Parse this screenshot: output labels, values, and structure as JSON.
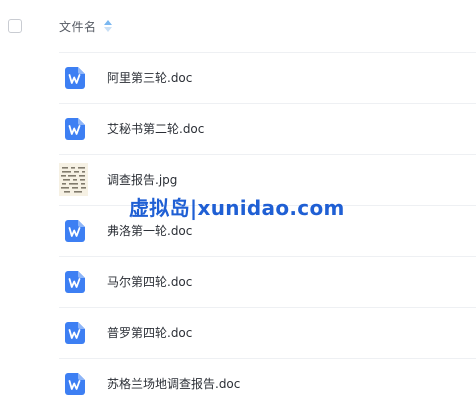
{
  "header": {
    "column_name": "文件名",
    "sort_icon": "sort-toggle-icon"
  },
  "files": [
    {
      "name": "阿里第三轮.doc",
      "icon": "word-doc-icon",
      "type": "doc"
    },
    {
      "name": "艾秘书第二轮.doc",
      "icon": "word-doc-icon",
      "type": "doc"
    },
    {
      "name": "调查报告.jpg",
      "icon": "image-thumbnail-icon",
      "type": "image"
    },
    {
      "name": "弗洛第一轮.doc",
      "icon": "word-doc-icon",
      "type": "doc"
    },
    {
      "name": "马尔第四轮.doc",
      "icon": "word-doc-icon",
      "type": "doc"
    },
    {
      "name": "普罗第四轮.doc",
      "icon": "word-doc-icon",
      "type": "doc"
    },
    {
      "name": "苏格兰场地调查报告.doc",
      "icon": "word-doc-icon",
      "type": "doc"
    }
  ],
  "watermark": {
    "text": "虚拟岛|xunidao.com"
  },
  "colors": {
    "doc_icon_blue": "#3d7ff3",
    "sort_icon": "#7ab7f0",
    "watermark": "#1f5fd4",
    "row_divider": "#eef0f3"
  }
}
